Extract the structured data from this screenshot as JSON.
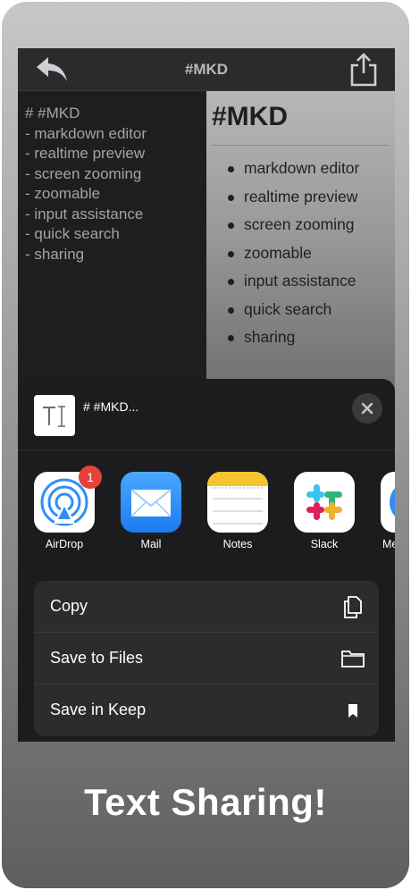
{
  "nav": {
    "title": "#MKD"
  },
  "editor": {
    "lines": [
      "# #MKD",
      "",
      "- markdown editor",
      "- realtime preview",
      "- screen zooming",
      "- zoomable",
      "- input assistance",
      "- quick search",
      "- sharing"
    ]
  },
  "preview": {
    "title": "#MKD",
    "items": [
      "markdown editor",
      "realtime preview",
      "screen zooming",
      "zoomable",
      "input assistance",
      "quick search",
      "sharing"
    ]
  },
  "share_sheet": {
    "doc_title": "# #MKD...",
    "apps": [
      {
        "label": "AirDrop",
        "icon": "airdrop-icon",
        "badge": "1"
      },
      {
        "label": "Mail",
        "icon": "mail-icon"
      },
      {
        "label": "Notes",
        "icon": "notes-icon"
      },
      {
        "label": "Slack",
        "icon": "slack-icon"
      },
      {
        "label": "Me",
        "icon": "messenger-icon"
      }
    ],
    "actions": [
      {
        "label": "Copy",
        "icon": "copy-icon"
      },
      {
        "label": "Save to Files",
        "icon": "folder-icon"
      },
      {
        "label": "Save in Keep",
        "icon": "bookmark-icon"
      }
    ]
  },
  "caption": "Text Sharing!",
  "colors": {
    "badge": "#e5413a",
    "mail": "#2f8ff7",
    "notes_yellow": "#f6c42c"
  }
}
